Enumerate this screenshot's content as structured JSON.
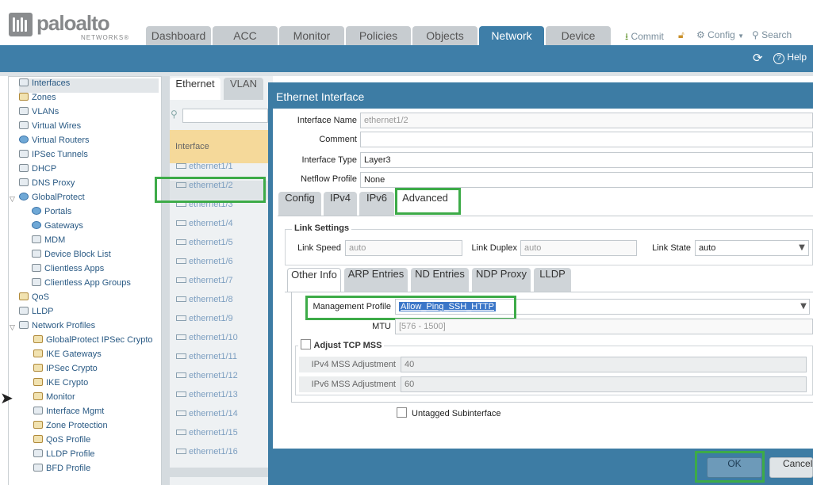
{
  "header": {
    "brand": "paloalto",
    "brand_sub": "NETWORKS®",
    "tabs": [
      "Dashboard",
      "ACC",
      "Monitor",
      "Policies",
      "Objects",
      "Network",
      "Device"
    ],
    "active_tab": "Network",
    "actions": {
      "commit": "Commit",
      "config": "Config",
      "search": "Search"
    }
  },
  "toolbar": {
    "help": "Help"
  },
  "sidebar": {
    "items": [
      "Interfaces",
      "Zones",
      "VLANs",
      "Virtual Wires",
      "Virtual Routers",
      "IPSec Tunnels",
      "DHCP",
      "DNS Proxy",
      "GlobalProtect",
      "Portals",
      "Gateways",
      "MDM",
      "Device Block List",
      "Clientless Apps",
      "Clientless App Groups",
      "QoS",
      "LLDP",
      "Network Profiles",
      "GlobalProtect IPSec Crypto",
      "IKE Gateways",
      "IPSec Crypto",
      "IKE Crypto",
      "Monitor",
      "Interface Mgmt",
      "Zone Protection",
      "QoS Profile",
      "LLDP Profile",
      "BFD Profile"
    ],
    "selected": "Interfaces"
  },
  "list": {
    "tabs": [
      "Ethernet",
      "VLAN"
    ],
    "column": "Interface",
    "rows": [
      "ethernet1/1",
      "ethernet1/2",
      "ethernet1/3",
      "ethernet1/4",
      "ethernet1/5",
      "ethernet1/6",
      "ethernet1/7",
      "ethernet1/8",
      "ethernet1/9",
      "ethernet1/10",
      "ethernet1/11",
      "ethernet1/12",
      "ethernet1/13",
      "ethernet1/14",
      "ethernet1/15",
      "ethernet1/16"
    ]
  },
  "dialog": {
    "title": "Ethernet Interface",
    "fields": {
      "interface_name_label": "Interface Name",
      "interface_name": "ethernet1/2",
      "comment_label": "Comment",
      "comment": "",
      "interface_type_label": "Interface Type",
      "interface_type": "Layer3",
      "netflow_label": "Netflow Profile",
      "netflow": "None"
    },
    "tabs": [
      "Config",
      "IPv4",
      "IPv6",
      "Advanced"
    ],
    "active_tab": "Advanced",
    "link_settings": {
      "legend": "Link Settings",
      "speed_label": "Link Speed",
      "speed_placeholder": "auto",
      "duplex_label": "Link Duplex",
      "duplex_placeholder": "auto",
      "state_label": "Link State",
      "state": "auto"
    },
    "inner_tabs": [
      "Other Info",
      "ARP Entries",
      "ND Entries",
      "NDP Proxy",
      "LLDP"
    ],
    "inner_active": "Other Info",
    "other_info": {
      "mgmt_label": "Management Profile",
      "mgmt": "Allow_Ping_SSH_HTTP",
      "mtu_label": "MTU",
      "mtu_placeholder": "[576 - 1500]",
      "tcp_mss_label": "Adjust TCP MSS",
      "ipv4_mss_label": "IPv4 MSS Adjustment",
      "ipv4_mss": "40",
      "ipv6_mss_label": "IPv6 MSS Adjustment",
      "ipv6_mss": "60",
      "untagged_label": "Untagged Subinterface"
    },
    "buttons": {
      "ok": "OK",
      "cancel": "Cancel"
    }
  },
  "colors": {
    "nav_blue": "#3e7ea8",
    "highlight_green": "#3dab48",
    "header_yellow": "#f5d99a"
  }
}
